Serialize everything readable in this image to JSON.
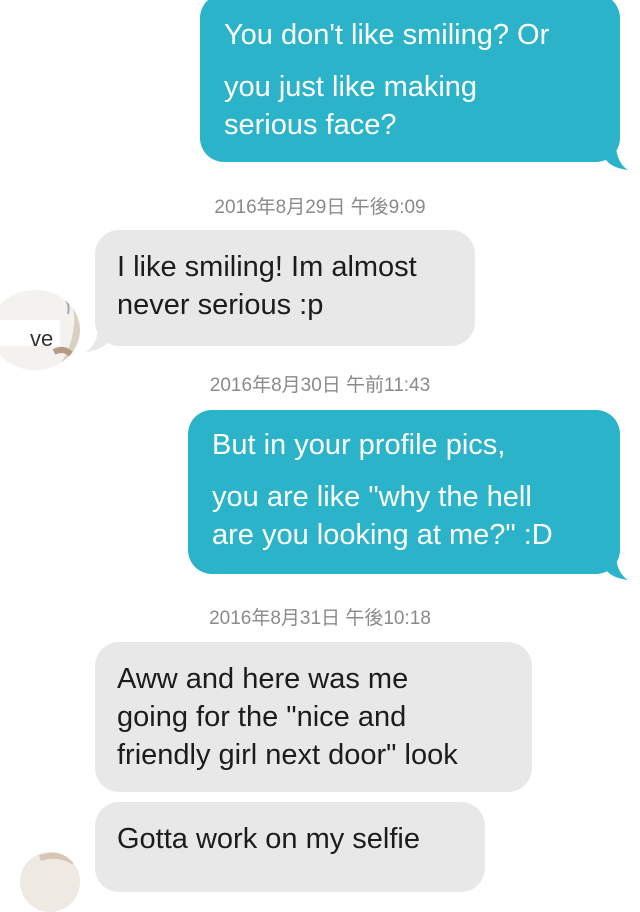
{
  "messages": [
    {
      "direction": "sent",
      "lines": [
        "You don't like smiling? Or",
        "you just like making",
        "serious face?"
      ]
    },
    {
      "direction": "received",
      "lines": [
        "I like smiling! Im almost",
        "never serious :p"
      ]
    },
    {
      "direction": "sent",
      "lines": [
        "But in your profile pics,",
        "you are like \"why the hell",
        "are you looking at me?\" :D"
      ]
    },
    {
      "direction": "received",
      "lines": [
        "Aww and here was me",
        "going for the \"nice and",
        "friendly girl next door\" look"
      ]
    },
    {
      "direction": "received",
      "lines": [
        "Gotta work on my selfie"
      ]
    }
  ],
  "timestamps": [
    "2016年8月29日 午後9:09",
    "2016年8月30日 午前11:43",
    "2016年8月31日 午後10:18"
  ],
  "avatar": {
    "partial_text": "ve"
  },
  "colors": {
    "sent_bubble": "#2bb3c9",
    "received_bubble": "#e8e8e9",
    "timestamp_text": "#8a8a8e"
  }
}
